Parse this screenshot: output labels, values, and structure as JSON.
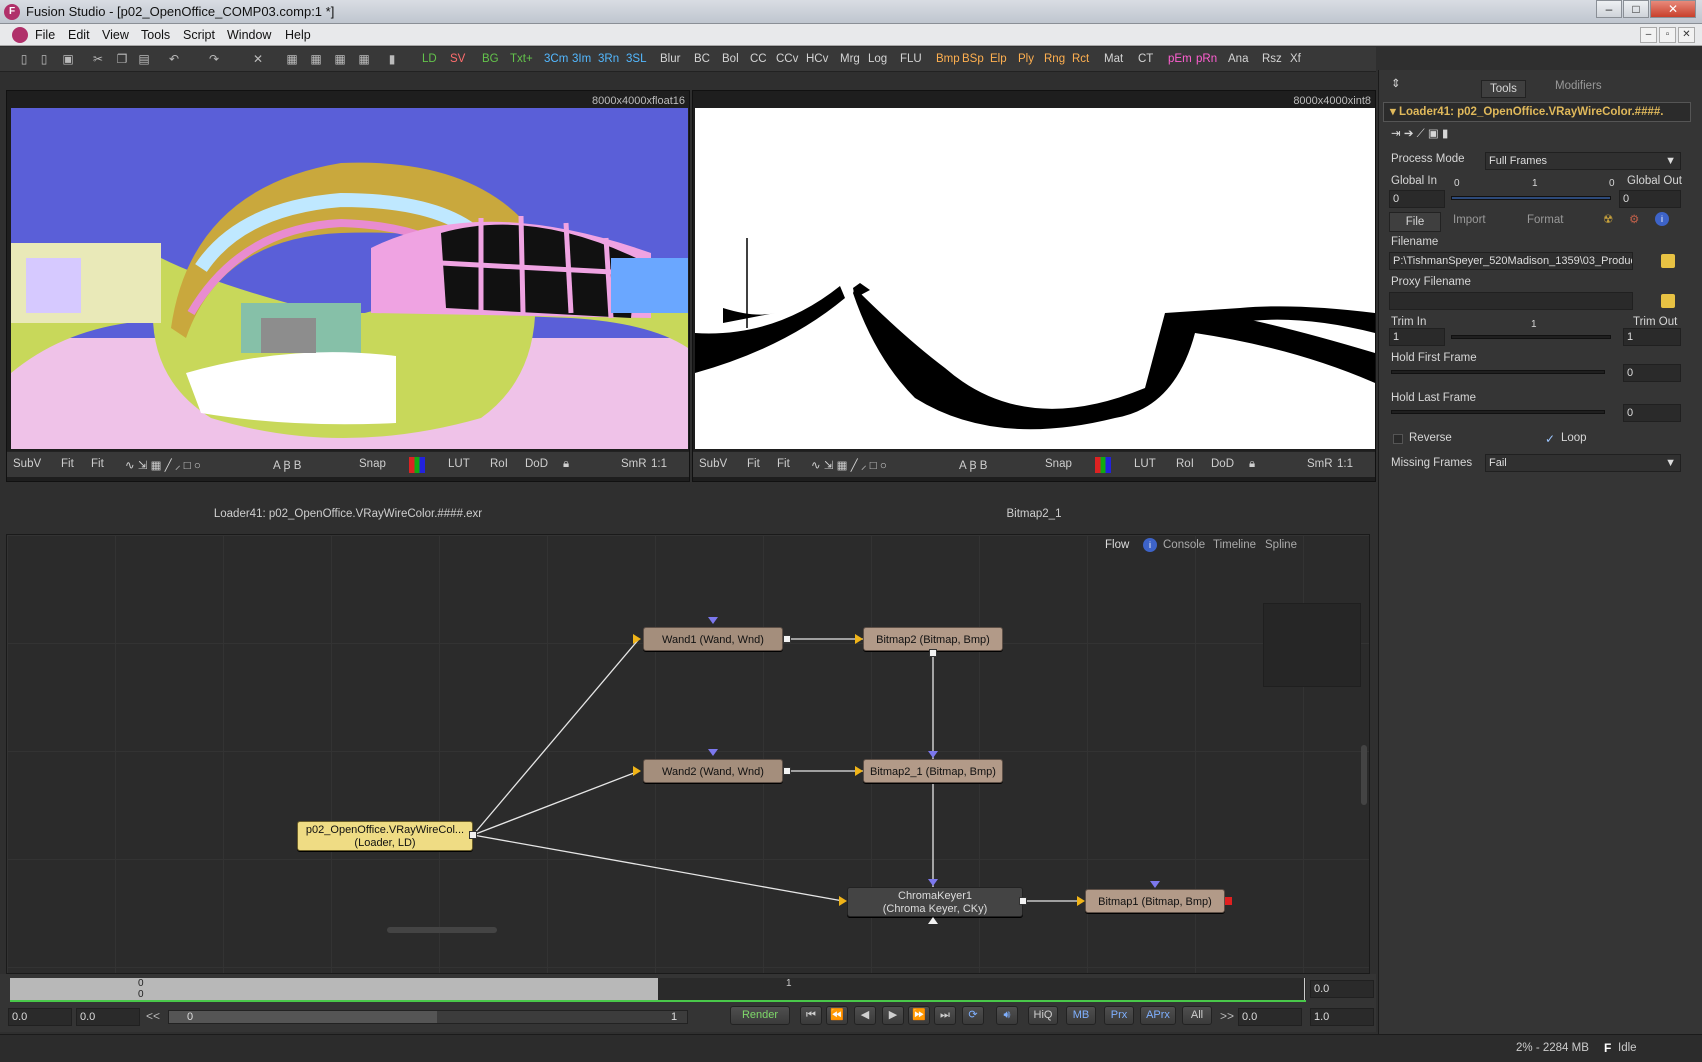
{
  "window": {
    "title": "Fusion Studio - [p02_OpenOffice_COMP03.comp:1 *]",
    "min": "–",
    "max": "□",
    "close": "✕"
  },
  "menu": [
    "File",
    "Edit",
    "View",
    "Tools",
    "Script",
    "Window",
    "Help"
  ],
  "toolbar": {
    "groups": [
      {
        "label": "LD",
        "color": "green"
      },
      {
        "label": "SV",
        "color": "red"
      },
      {
        "label": "BG",
        "color": "green"
      },
      {
        "label": "Txt+",
        "color": "green"
      },
      {
        "label": "3Cm",
        "color": "cyan"
      },
      {
        "label": "3Im",
        "color": "cyan"
      },
      {
        "label": "3Rn",
        "color": "cyan"
      },
      {
        "label": "3SL",
        "color": "cyan"
      },
      {
        "label": "Blur",
        "color": "white"
      },
      {
        "label": "BC",
        "color": "white"
      },
      {
        "label": "Bol",
        "color": "white"
      },
      {
        "label": "CC",
        "color": "white"
      },
      {
        "label": "CCv",
        "color": "white"
      },
      {
        "label": "HCv",
        "color": "white"
      },
      {
        "label": "Mrg",
        "color": "white"
      },
      {
        "label": "Log",
        "color": "white"
      },
      {
        "label": "FLU",
        "color": "white"
      },
      {
        "label": "Bmp",
        "color": "orange"
      },
      {
        "label": "BSp",
        "color": "orange"
      },
      {
        "label": "Elp",
        "color": "orange"
      },
      {
        "label": "Ply",
        "color": "orange"
      },
      {
        "label": "Rng",
        "color": "orange"
      },
      {
        "label": "Rct",
        "color": "orange"
      },
      {
        "label": "Mat",
        "color": "white"
      },
      {
        "label": "CT",
        "color": "white"
      },
      {
        "label": "pEm",
        "color": "magenta"
      },
      {
        "label": "pRn",
        "color": "magenta"
      },
      {
        "label": "Ana",
        "color": "white"
      },
      {
        "label": "Rsz",
        "color": "white"
      },
      {
        "label": "Xf",
        "color": "white"
      }
    ]
  },
  "viewer1": {
    "size": "8000x4000xfloat16",
    "caption": "Loader41: p02_OpenOffice.VRayWireColor.####.exr"
  },
  "viewer2": {
    "size": "8000x4000xint8",
    "caption": "Bitmap2_1"
  },
  "viewerbar": {
    "subv": "SubV",
    "fit1": "Fit",
    "fit2": "Fit",
    "snap": "Snap",
    "lut": "LUT",
    "roi": "RoI",
    "dod": "DoD",
    "smr": "SmR",
    "ratio": "1:1"
  },
  "flowtabs": {
    "flow": "Flow",
    "console": "Console",
    "timeline": "Timeline",
    "spline": "Spline"
  },
  "nodes": {
    "wand1": "Wand1  (Wand, Wnd)",
    "bitmap2": "Bitmap2  (Bitmap, Bmp)",
    "wand2": "Wand2  (Wand, Wnd)",
    "bitmap2_1": "Bitmap2_1  (Bitmap, Bmp)",
    "loader_l1": "p02_OpenOffice.VRayWireCol...",
    "loader_l2": "(Loader, LD)",
    "ckey_l1": "ChromaKeyer1",
    "ckey_l2": "(Chroma Keyer, CKy)",
    "bitmap1": "Bitmap1  (Bitmap, Bmp)"
  },
  "inspector": {
    "tabs": {
      "tools": "Tools",
      "modifiers": "Modifiers"
    },
    "header": "Loader41: p02_OpenOffice.VRayWireColor.####.",
    "process_mode_label": "Process Mode",
    "process_mode": "Full Frames",
    "global_in_label": "Global In",
    "global_out_label": "Global Out",
    "global_in": "0",
    "global_out": "0",
    "gscale0": "0",
    "gscale1": "1",
    "gscale2": "0",
    "subtabs": {
      "file": "File",
      "import": "Import",
      "format": "Format"
    },
    "filename_label": "Filename",
    "filename": "P:\\TishmanSpeyer_520Madison_1359\\03_Production",
    "proxy_label": "Proxy Filename",
    "trim_in_label": "Trim In",
    "trim_out_label": "Trim Out",
    "trim_in": "1",
    "trim_out": "1",
    "trim_mid": "1",
    "hold_first_label": "Hold First Frame",
    "hold_first": "0",
    "hold_last_label": "Hold Last Frame",
    "hold_last": "0",
    "reverse": "Reverse",
    "loop": "Loop",
    "missing_label": "Missing Frames",
    "missing": "Fail"
  },
  "timeline": {
    "top0": "0",
    "top1": "0",
    "mark1": "1",
    "right": "0.0",
    "start": "0.0",
    "end": "0.0",
    "range_start": "0",
    "range_end": "1",
    "cur": "0.0",
    "step": "1.0"
  },
  "playback": {
    "render": "Render",
    "hiq": "HiQ",
    "mb": "MB",
    "prx": "Prx",
    "aprx": "APrx",
    "all": "All"
  },
  "status": {
    "mem": "2% - 2284 MB",
    "state": "Idle"
  }
}
